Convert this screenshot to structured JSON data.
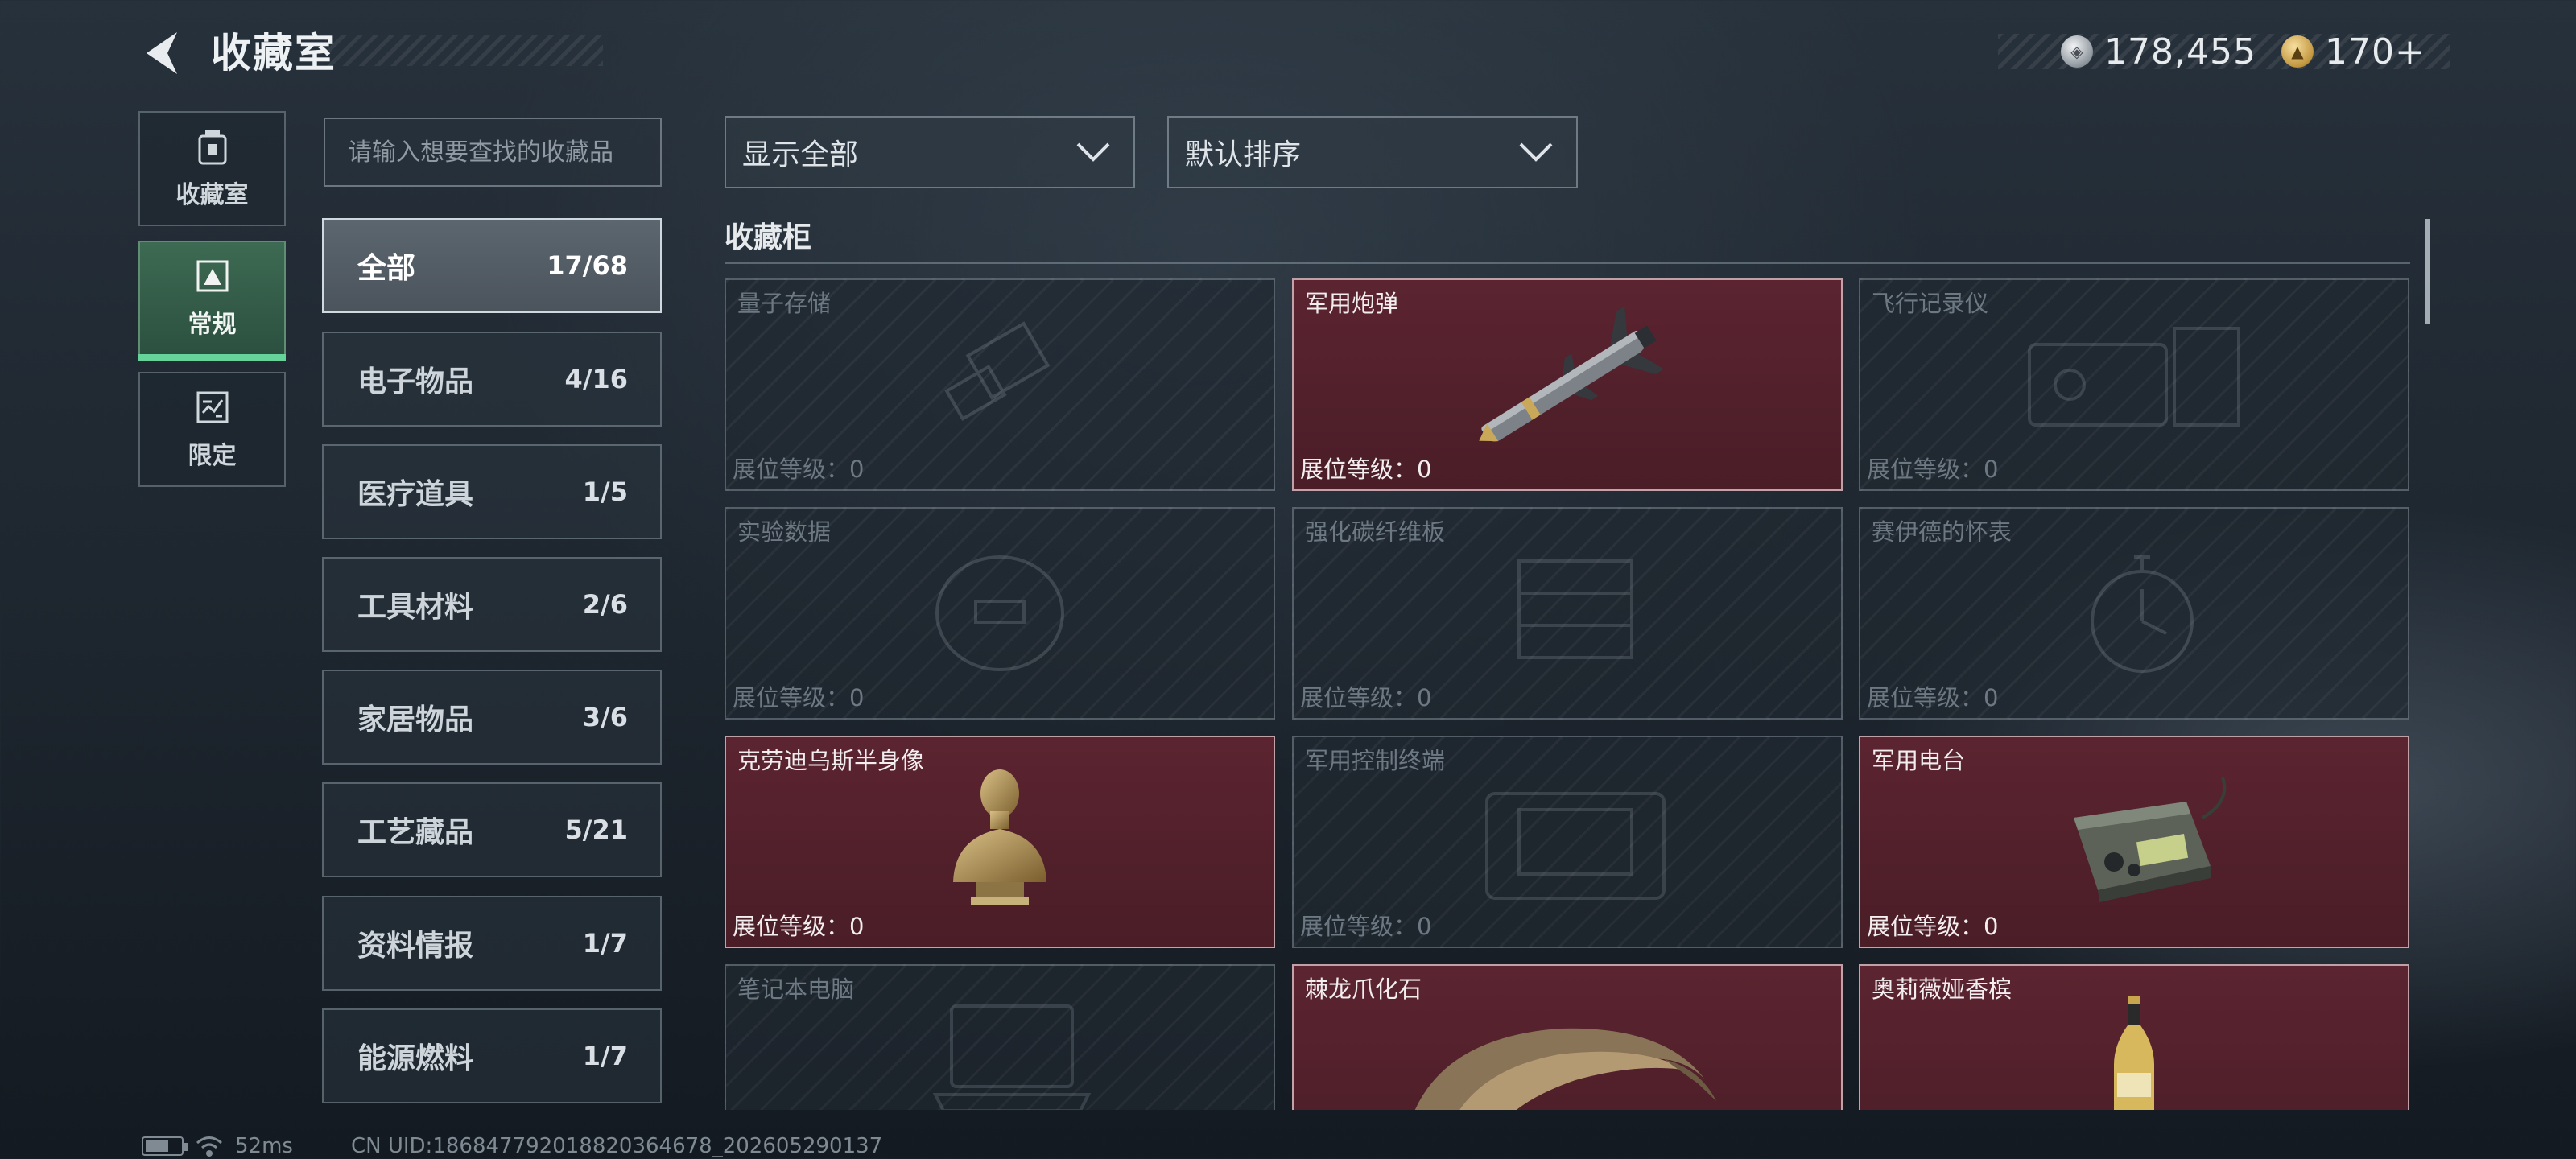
{
  "header": {
    "title": "收藏室",
    "currencies": [
      {
        "icon": "silver-coin-icon",
        "value": "178,455"
      },
      {
        "icon": "gold-coin-icon",
        "value": "170+"
      }
    ]
  },
  "left_nav": [
    {
      "label": "收藏室",
      "icon": "collection-room-icon",
      "active": false
    },
    {
      "label": "常规",
      "icon": "regular-icon",
      "active": true
    },
    {
      "label": "限定",
      "icon": "limited-icon",
      "active": false
    }
  ],
  "search": {
    "placeholder": "请输入想要查找的收藏品",
    "value": ""
  },
  "categories": [
    {
      "name": "全部",
      "count": "17/68",
      "active": true
    },
    {
      "name": "电子物品",
      "count": "4/16"
    },
    {
      "name": "医疗道具",
      "count": "1/5"
    },
    {
      "name": "工具材料",
      "count": "2/6"
    },
    {
      "name": "家居物品",
      "count": "3/6"
    },
    {
      "name": "工艺藏品",
      "count": "5/21"
    },
    {
      "name": "资料情报",
      "count": "1/7"
    },
    {
      "name": "能源燃料",
      "count": "1/7"
    }
  ],
  "filters": {
    "show": "显示全部",
    "sort": "默认排序"
  },
  "section": {
    "title": "收藏柜"
  },
  "level_label": "展位等级：",
  "items": [
    {
      "name": "量子存储",
      "level": "0",
      "unlocked": false,
      "icon": "usb-drive-icon"
    },
    {
      "name": "军用炮弹",
      "level": "0",
      "unlocked": true,
      "icon": "missile-icon"
    },
    {
      "name": "飞行记录仪",
      "level": "0",
      "unlocked": false,
      "icon": "flight-recorder-icon"
    },
    {
      "name": "实验数据",
      "level": "0",
      "unlocked": false,
      "icon": "data-disc-icon"
    },
    {
      "name": "强化碳纤维板",
      "level": "0",
      "unlocked": false,
      "icon": "carbon-plate-icon"
    },
    {
      "name": "赛伊德的怀表",
      "level": "0",
      "unlocked": false,
      "icon": "pocket-watch-icon"
    },
    {
      "name": "克劳迪乌斯半身像",
      "level": "0",
      "unlocked": true,
      "icon": "bust-statue-icon"
    },
    {
      "name": "军用控制终端",
      "level": "0",
      "unlocked": false,
      "icon": "control-terminal-icon"
    },
    {
      "name": "军用电台",
      "level": "0",
      "unlocked": true,
      "icon": "radio-icon"
    },
    {
      "name": "笔记本电脑",
      "level": "",
      "unlocked": false,
      "icon": "laptop-icon"
    },
    {
      "name": "棘龙爪化石",
      "level": "",
      "unlocked": true,
      "icon": "claw-fossil-icon"
    },
    {
      "name": "奥莉薇娅香槟",
      "level": "",
      "unlocked": true,
      "icon": "champagne-bottle-icon"
    }
  ],
  "footer": {
    "ping": "52ms",
    "uid": "CN UID:186847792018820364678_202605290137"
  },
  "colors": {
    "accent_green": "#66d39b",
    "unlocked_card": "#5b2430"
  }
}
